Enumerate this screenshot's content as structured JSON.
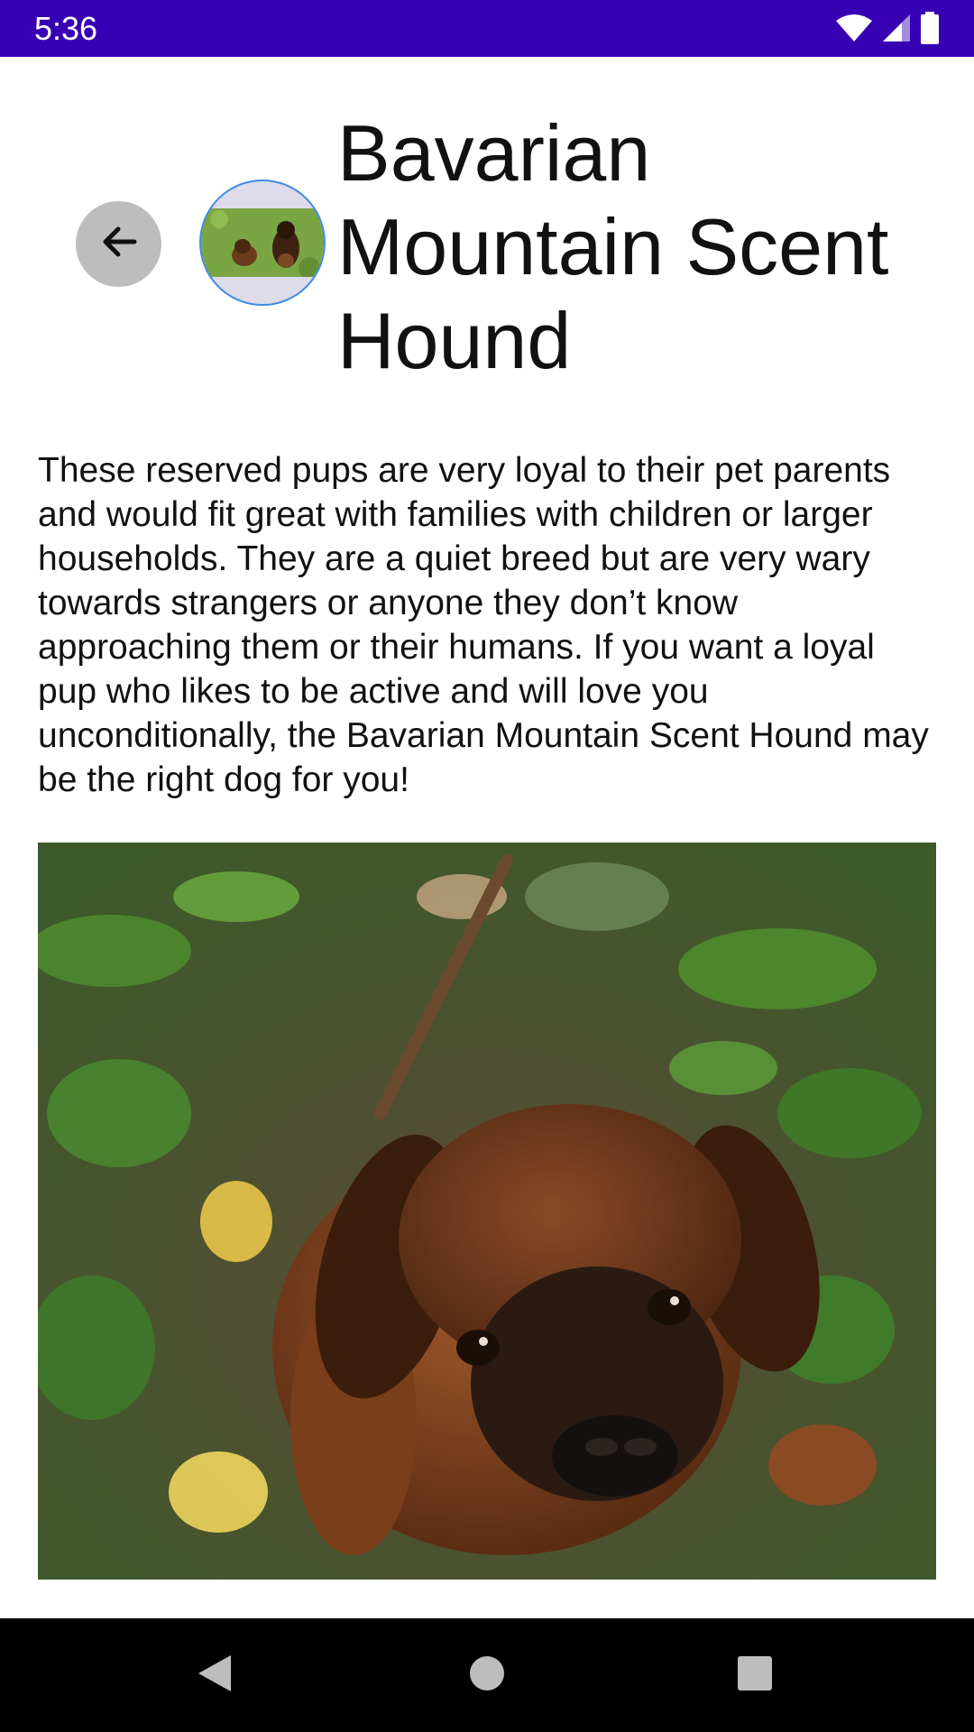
{
  "status_bar": {
    "time": "5:36",
    "background": "#3700b3",
    "icons": [
      "wifi-icon",
      "cell-signal-icon",
      "battery-icon"
    ]
  },
  "header": {
    "back_icon": "arrow-left-icon",
    "avatar_image": "two-dogs-on-grass-thumbnail",
    "title": "Bavarian Mountain Scent Hound"
  },
  "content": {
    "description": "These reserved pups are very loyal to their pet parents and would fit great with families with children or larger households. They are a quiet breed but are very wary towards strangers or anyone they don’t know approaching them or their humans. If you want a loyal pup who likes to be active and will love you unconditionally, the Bavarian Mountain Scent Hound may be the right dog for you!",
    "photo": "brown-puppy-looking-up-on-grass"
  },
  "nav_bar": {
    "items": [
      "back-triangle-icon",
      "home-circle-icon",
      "recents-square-icon"
    ]
  },
  "colors": {
    "accent_ring": "#3f8be6",
    "back_button_bg": "#bdbdbd"
  }
}
